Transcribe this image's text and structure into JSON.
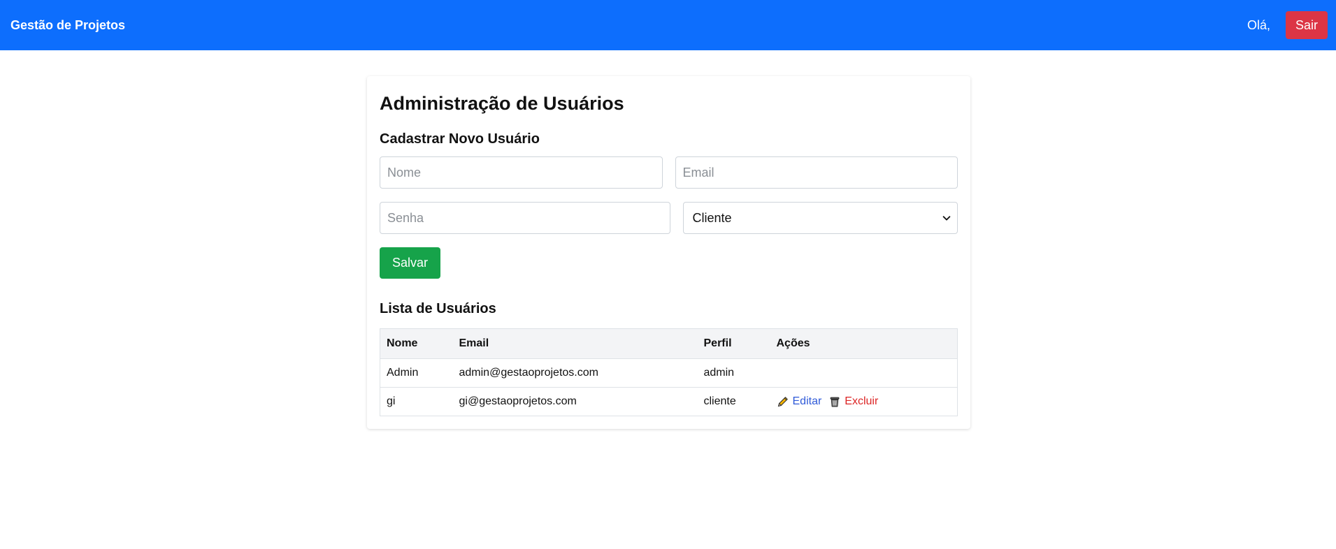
{
  "navbar": {
    "brand": "Gestão de Projetos",
    "greeting": "Olá,",
    "logout_label": "Sair"
  },
  "page": {
    "title": "Administração de Usuários"
  },
  "form": {
    "title": "Cadastrar Novo Usuário",
    "name_placeholder": "Nome",
    "email_placeholder": "Email",
    "password_placeholder": "Senha",
    "role_selected": "Cliente",
    "save_label": "Salvar"
  },
  "list": {
    "title": "Lista de Usuários",
    "columns": [
      "Nome",
      "Email",
      "Perfil",
      "Ações"
    ],
    "rows": [
      {
        "name": "Admin",
        "email": "admin@gestaoprojetos.com",
        "role": "admin",
        "actions": []
      },
      {
        "name": "gi",
        "email": "gi@gestaoprojetos.com",
        "role": "cliente",
        "actions": [
          "Editar",
          "Excluir"
        ]
      }
    ]
  },
  "colors": {
    "navbar": "#0d6efd",
    "logout": "#dc3545",
    "save": "#16a34a",
    "edit_link": "#2f5ad8",
    "delete_link": "#dc2626"
  },
  "icons": {
    "edit": "pencil-icon",
    "delete": "trash-icon",
    "select": "chevron-down-icon"
  }
}
